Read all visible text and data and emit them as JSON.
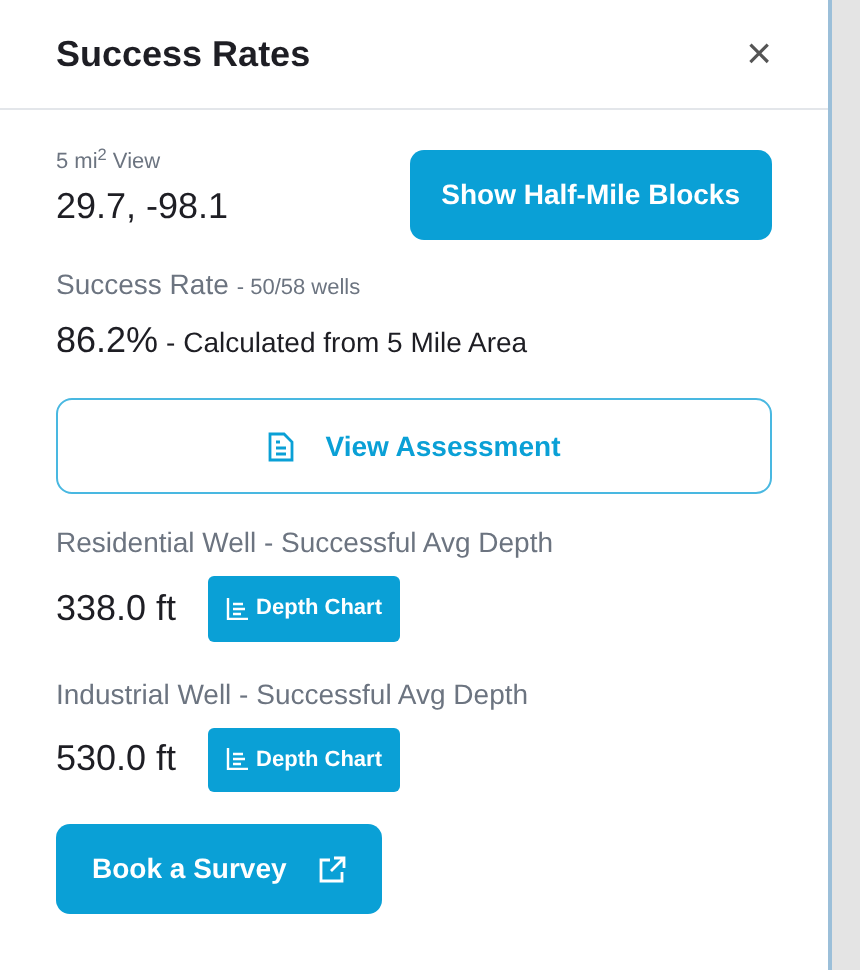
{
  "panel": {
    "title": "Success Rates",
    "close": "×"
  },
  "view": {
    "label": "5 mi$^{2}$ View",
    "coords": "29.7, -98.1",
    "button": "Show Half-Mile Blocks"
  },
  "success": {
    "label": "Success Rate",
    "detail": "- 50/58 wells",
    "value": "86.2%",
    "note": "- Calculated from 5 Mile Area"
  },
  "assessment_button": "View Assessment",
  "depths": [
    {
      "label": "Residential Well - Successful Avg Depth",
      "value": "338.0 ft",
      "button": "Depth Chart"
    },
    {
      "label": "Industrial Well - Successful Avg Depth",
      "value": "530.0 ft",
      "button": "Depth Chart"
    }
  ],
  "survey_button": "Book a Survey"
}
